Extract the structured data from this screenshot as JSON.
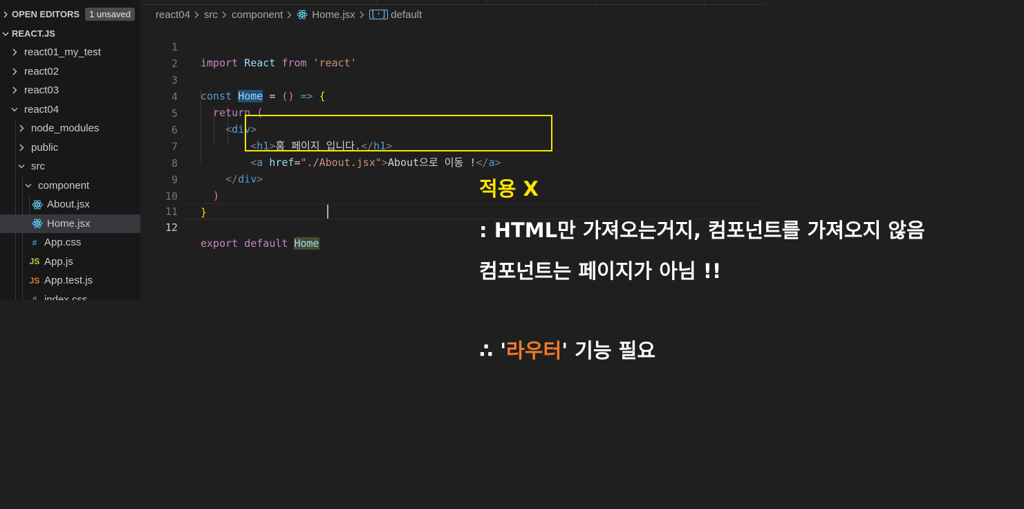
{
  "sidebar": {
    "open_editors_label": "OPEN EDITORS",
    "unsaved_badge": "1 unsaved",
    "workspace_label": "REACT.JS",
    "items": [
      {
        "label": "react01_my_test",
        "type": "folder",
        "expanded": false,
        "icon": "chevron-right-icon"
      },
      {
        "label": "react02",
        "type": "folder",
        "expanded": false,
        "icon": "chevron-right-icon"
      },
      {
        "label": "react03",
        "type": "folder",
        "expanded": false,
        "icon": "chevron-right-icon"
      },
      {
        "label": "react04",
        "type": "folder",
        "expanded": true,
        "icon": "chevron-down-icon"
      },
      {
        "label": "node_modules",
        "type": "folder",
        "expanded": false,
        "icon": "chevron-right-icon"
      },
      {
        "label": "public",
        "type": "folder",
        "expanded": false,
        "icon": "chevron-right-icon"
      },
      {
        "label": "src",
        "type": "folder",
        "expanded": true,
        "icon": "chevron-down-icon"
      },
      {
        "label": "component",
        "type": "folder",
        "expanded": true,
        "icon": "chevron-down-icon"
      },
      {
        "label": "About.jsx",
        "type": "file",
        "icon": "react-icon"
      },
      {
        "label": "Home.jsx",
        "type": "file",
        "icon": "react-icon",
        "selected": true
      },
      {
        "label": "App.css",
        "type": "file",
        "icon": "css-hash-icon",
        "icon_glyph": "#"
      },
      {
        "label": "App.js",
        "type": "file",
        "icon": "js-icon",
        "icon_glyph": "JS"
      },
      {
        "label": "App.test.js",
        "type": "file",
        "icon": "js-test-icon",
        "icon_glyph": "JS"
      },
      {
        "label": "index.css",
        "type": "file",
        "icon": "css-hash-icon",
        "icon_glyph": "#"
      }
    ]
  },
  "breadcrumb": {
    "parts": [
      "react04",
      "src",
      "component"
    ],
    "file": "Home.jsx",
    "symbol": "default"
  },
  "code": {
    "active_line": "12",
    "lines": [
      {
        "n": "1",
        "text": "import React from 'react'"
      },
      {
        "n": "2",
        "text": ""
      },
      {
        "n": "3",
        "text": "const Home = () => {"
      },
      {
        "n": "4",
        "text": "  return ("
      },
      {
        "n": "5",
        "text": "    <div>"
      },
      {
        "n": "6",
        "text": "        <h1>홈 페이지 입니다.</h1>"
      },
      {
        "n": "7",
        "text": "        <a href=\"./About.jsx\">About으로 이동 !</a>"
      },
      {
        "n": "8",
        "text": "    </div>"
      },
      {
        "n": "9",
        "text": "  )"
      },
      {
        "n": "10",
        "text": "}"
      },
      {
        "n": "11",
        "text": ""
      },
      {
        "n": "12",
        "text": "export default Home"
      }
    ],
    "tokens": {
      "import": "import",
      "react_ident": "React",
      "from": "from",
      "react_str": "'react'",
      "const": "const",
      "home": "Home",
      "eq": " = ",
      "paren_open": "(",
      "paren_close": ")",
      "arrow": " => ",
      "brace_open": "{",
      "brace_close": "}",
      "return": "return",
      "div_open_lt": "<",
      "div": "div",
      "gt": ">",
      "close_lt": "</",
      "h1": "h1",
      "h1_text": "홈 페이지 입니다.",
      "a": "a",
      "href": "href",
      "href_eq": "=",
      "href_val": "\"./About.jsx\"",
      "a_text": "About으로 이동 !",
      "export": "export",
      "default": "default"
    }
  },
  "annotation": {
    "title": "적용 X",
    "line1": ": HTML만 가져오는거지, 컴포넌트를 가져오지 않음",
    "line2": "컴포넌트는 페이지가 아님 !!",
    "line3_prefix": "∴ '",
    "line3_highlight": "라우터",
    "line3_suffix": "' 기능 필요"
  },
  "colors": {
    "background": "#1f1f1f",
    "sidebar": "#181818",
    "selected_row": "#37373d",
    "highlight_box": "#ffe600",
    "annotation_title": "#ffe600",
    "annotation_accent": "#f47a2a",
    "react_icon": "#61dafb",
    "css_icon": "#519aba",
    "js_icon": "#cbcb41",
    "js_test_icon": "#e37933"
  }
}
